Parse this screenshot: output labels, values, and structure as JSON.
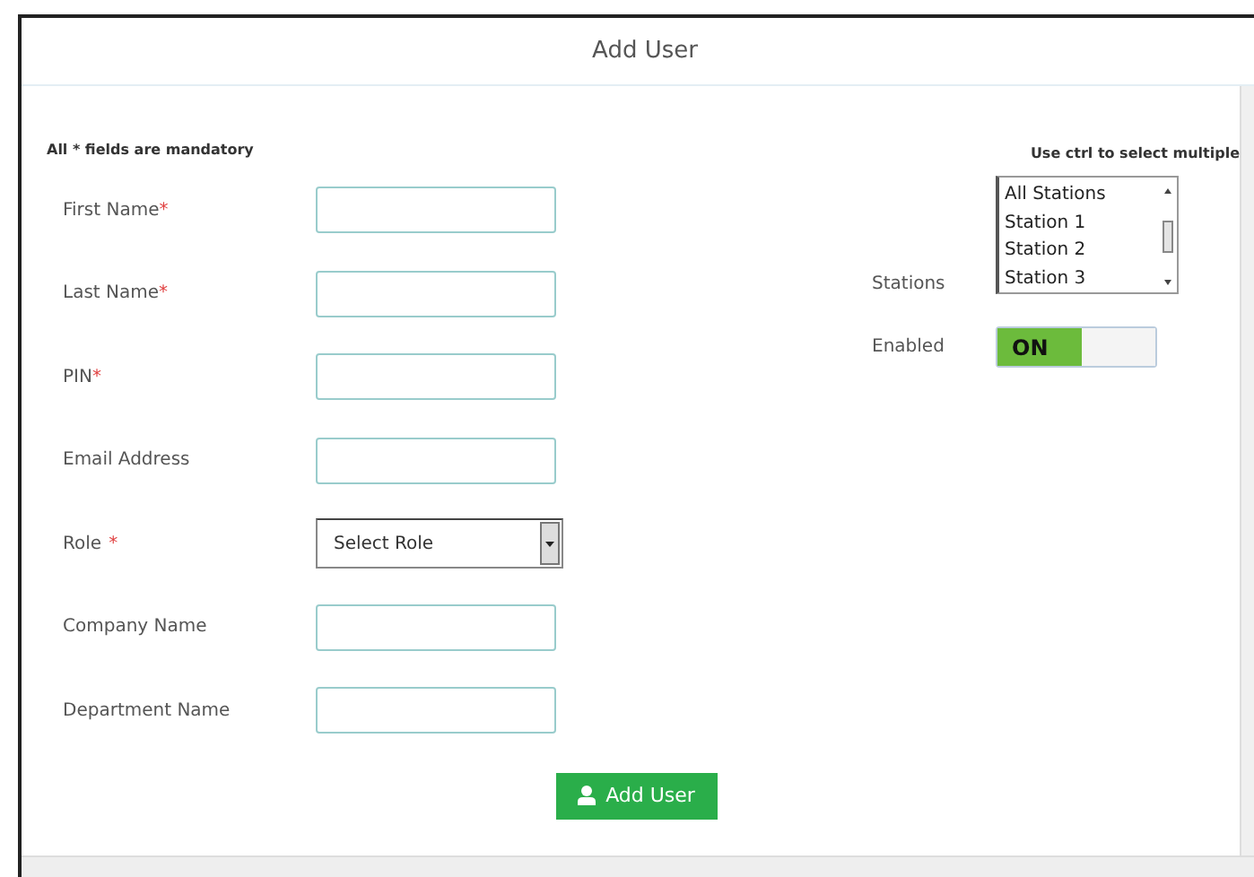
{
  "window": {
    "title": "Add User"
  },
  "mandatory_note": "All * fields are mandatory",
  "fields": [
    {
      "kind": "text",
      "label": "First Name",
      "mark": "*"
    },
    {
      "kind": "text",
      "label": "Last Name",
      "mark": "*"
    },
    {
      "kind": "text",
      "label": "PIN",
      "mark": "*"
    },
    {
      "kind": "text",
      "label": "Email Address"
    },
    {
      "kind": "select",
      "label": "Role",
      "mark": "*",
      "value": "Select Role"
    },
    {
      "kind": "text",
      "label": "Company Name"
    },
    {
      "kind": "text",
      "label": "Department Name"
    }
  ],
  "stations": {
    "hint": "Use ctrl to select multiple",
    "label": "Stations",
    "options": [
      "All Stations",
      "Station 1",
      "Station 2",
      "Station 3"
    ]
  },
  "enabled": {
    "label": "Enabled",
    "on": true,
    "text": "ON"
  },
  "submit": {
    "label": "Add User"
  }
}
